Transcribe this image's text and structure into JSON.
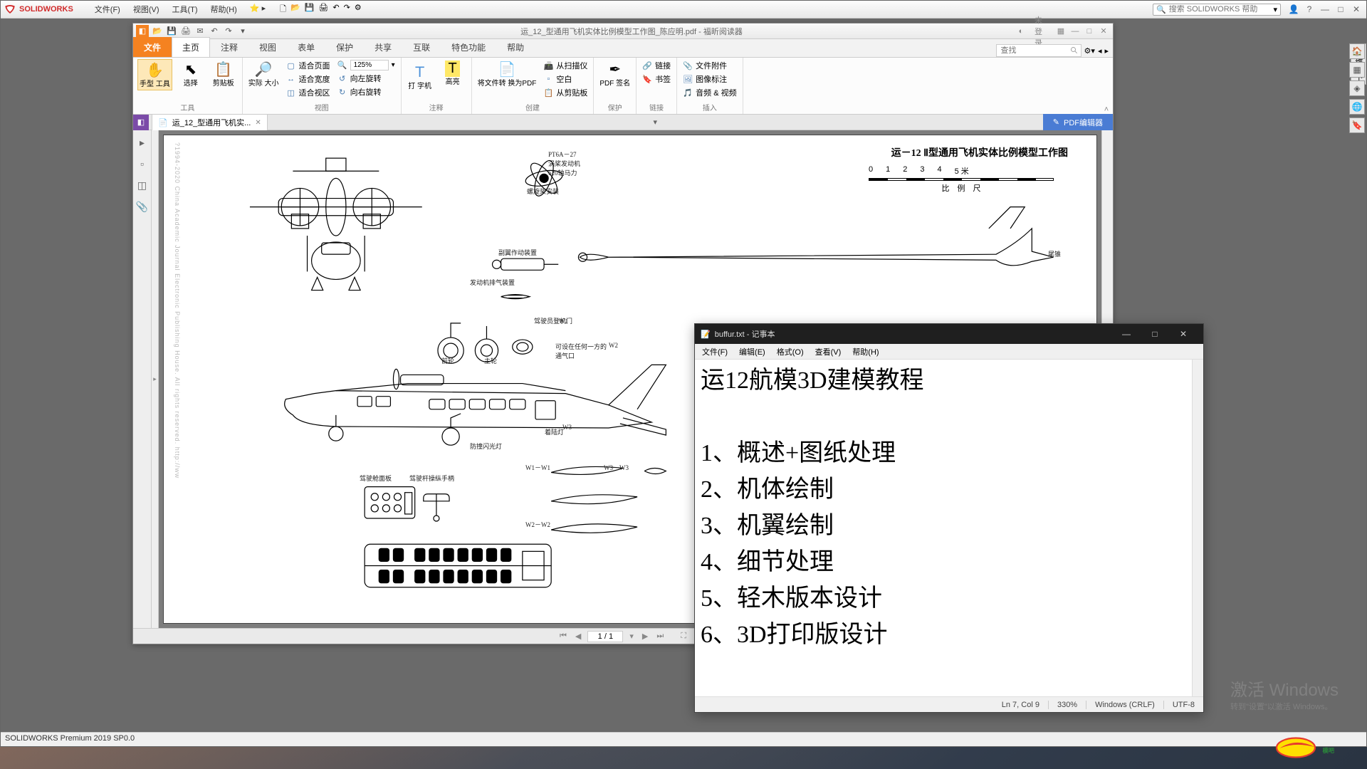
{
  "solidworks": {
    "brand": "SOLIDWORKS",
    "menus": [
      "文件(F)",
      "视图(V)",
      "工具(T)",
      "帮助(H)"
    ],
    "search_placeholder": "搜索 SOLIDWORKS 帮助",
    "status": "SOLIDWORKS Premium 2019 SP0.0",
    "weitang": "维棠下",
    "right_icons": [
      "home-icon",
      "stack-icon",
      "badge-icon",
      "globe-icon",
      "tag-icon"
    ]
  },
  "foxit": {
    "doc_title": "运_12_型通用飞机实体比例模型工作图_陈应明.pdf - 福昕阅读器",
    "login": "未登录",
    "tabs": {
      "file": "文件",
      "items": [
        "主页",
        "注释",
        "视图",
        "表单",
        "保护",
        "共享",
        "互联",
        "特色功能",
        "帮助"
      ],
      "active": "主页"
    },
    "find_placeholder": "查找",
    "ribbon": {
      "tools": {
        "label": "工具",
        "hand": "手型\n工具",
        "select": "选择",
        "snapshot": "剪贴板"
      },
      "view": {
        "label": "视图",
        "actual": "实际\n大小",
        "fit_page": "适合页面",
        "fit_width": "适合宽度",
        "fit_visible": "适合视区",
        "zoom": "125%",
        "reflow": "向左旋转",
        "rotate_l": "向左旋转",
        "rotate_r": "向右旋转"
      },
      "comment": {
        "label": "注释",
        "typewriter": "打\n字机",
        "highlight": "高亮"
      },
      "create": {
        "label": "创建",
        "convert": "将文件转\n换为PDF",
        "from_scanner": "从扫描仪",
        "blank": "空白",
        "from_clip": "从剪贴板"
      },
      "protect": {
        "label": "保护",
        "sign": "PDF\n签名"
      },
      "links": {
        "label": "链接",
        "link": "链接",
        "bookmark": "书签"
      },
      "insert": {
        "label": "插入",
        "file_attach": "文件附件",
        "image_annot": "图像标注",
        "audio_video": "音频 & 视频"
      }
    },
    "doctab": "运_12_型通用飞机实...",
    "pdf_editor": "PDF编辑器",
    "page": {
      "current": "1 / 1"
    },
    "blueprint": {
      "title": "运－12 Ⅱ型通用飞机实体比例模型工作图",
      "scale_ticks": [
        "0",
        "1",
        "2",
        "3",
        "4",
        "5 米"
      ],
      "scale_label": "比　例　尺",
      "engine_label": "PT6A－27\n涡桨发动机\n620轴马力",
      "prop_label": "螺旋桨安装",
      "flap_label": "副翼作动装置",
      "exhaust_label": "发动机排气装置",
      "tailcone_label": "尾锥",
      "crew_door": "驾驶员登机门",
      "main_gear": "主轮",
      "nose_gear": "前轮",
      "vent": "可设在任何一方的\n通气口",
      "landing_light": "着陆灯",
      "anti_collision": "防撞闪光灯",
      "cockpit_panel": "驾驶舱面板",
      "control_column": "驾驶杆操纵手柄",
      "w_labels": [
        "W1",
        "W2",
        "W3",
        "W1－W1",
        "W2－W2",
        "W3－W3"
      ],
      "copyright": "?1994-2020 China Academic Journal Electronic Publishing House. All rights reserved.  http://ww"
    }
  },
  "notepad": {
    "title": "buffur.txt - 记事本",
    "menus": [
      "文件(F)",
      "编辑(E)",
      "格式(O)",
      "查看(V)",
      "帮助(H)"
    ],
    "content_lines": [
      "运12航模3D建模教程",
      "",
      "1、概述+图纸处理",
      "2、机体绘制",
      "3、机翼绘制",
      "4、细节处理",
      "5、轻木版本设计",
      "6、3D打印版设计"
    ],
    "status": {
      "pos": "Ln 7,  Col 9",
      "zoom": "330%",
      "eol": "Windows (CRLF)",
      "enc": "UTF-8"
    }
  },
  "watermark": {
    "line1": "激活 Windows",
    "line2": "转到\"设置\"以激活 Windows。"
  },
  "moba": "模吧"
}
